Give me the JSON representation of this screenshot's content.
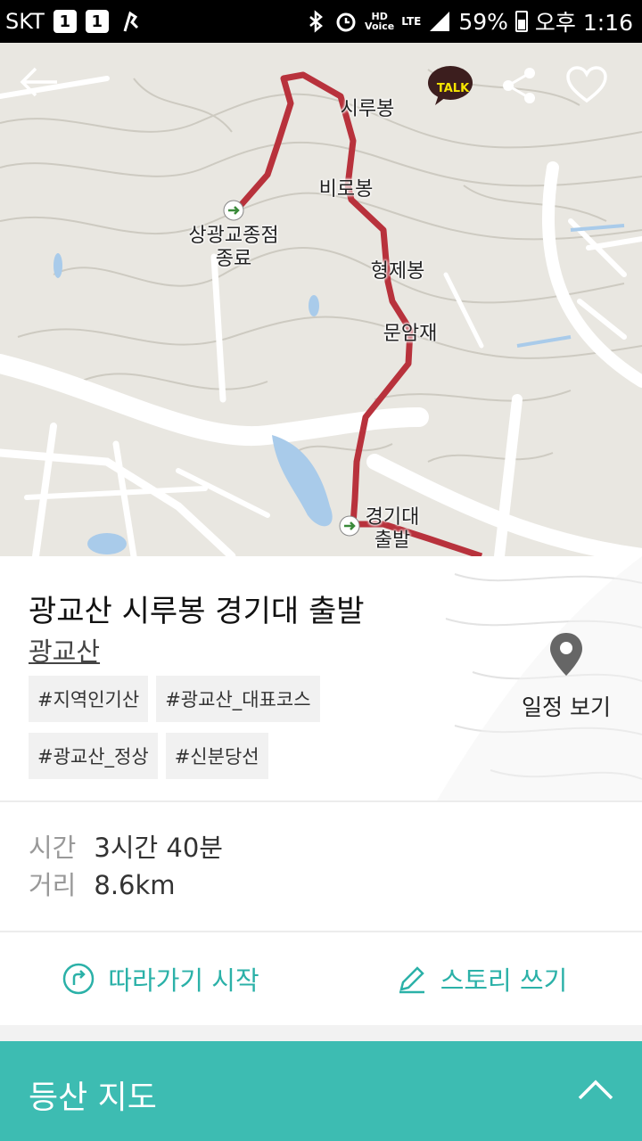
{
  "status_bar": {
    "carrier": "SKT",
    "notif_1": "1",
    "notif_2": "1",
    "network": "LTE",
    "battery": "59%",
    "time": "오후 1:16"
  },
  "map": {
    "labels": {
      "sirubong": "시루봉",
      "birobong": "비로봉",
      "sanggwang": "상광교종점\n종료",
      "hyeongjebong": "형제봉",
      "munamjae": "문암재",
      "kyonggi": "경기대\n출발"
    },
    "kakao_talk_label": "TALK",
    "route_color": "#b8323c"
  },
  "course": {
    "title": "광교산 시루봉 경기대 출발",
    "mountain": "광교산",
    "tags": [
      "#지역인기산",
      "#광교산_대표코스",
      "#광교산_정상",
      "#신분당선"
    ],
    "schedule_label": "일정 보기"
  },
  "stats": {
    "time_label": "시간",
    "time_value": "3시간 40분",
    "distance_label": "거리",
    "distance_value": "8.6km"
  },
  "actions": {
    "follow_label": "따라가기 시작",
    "story_label": "스토리 쓰기"
  },
  "bottom_panel": {
    "title": "등산 지도"
  },
  "colors": {
    "accent": "#3dbcb2",
    "action_text": "#2bb1a8"
  }
}
